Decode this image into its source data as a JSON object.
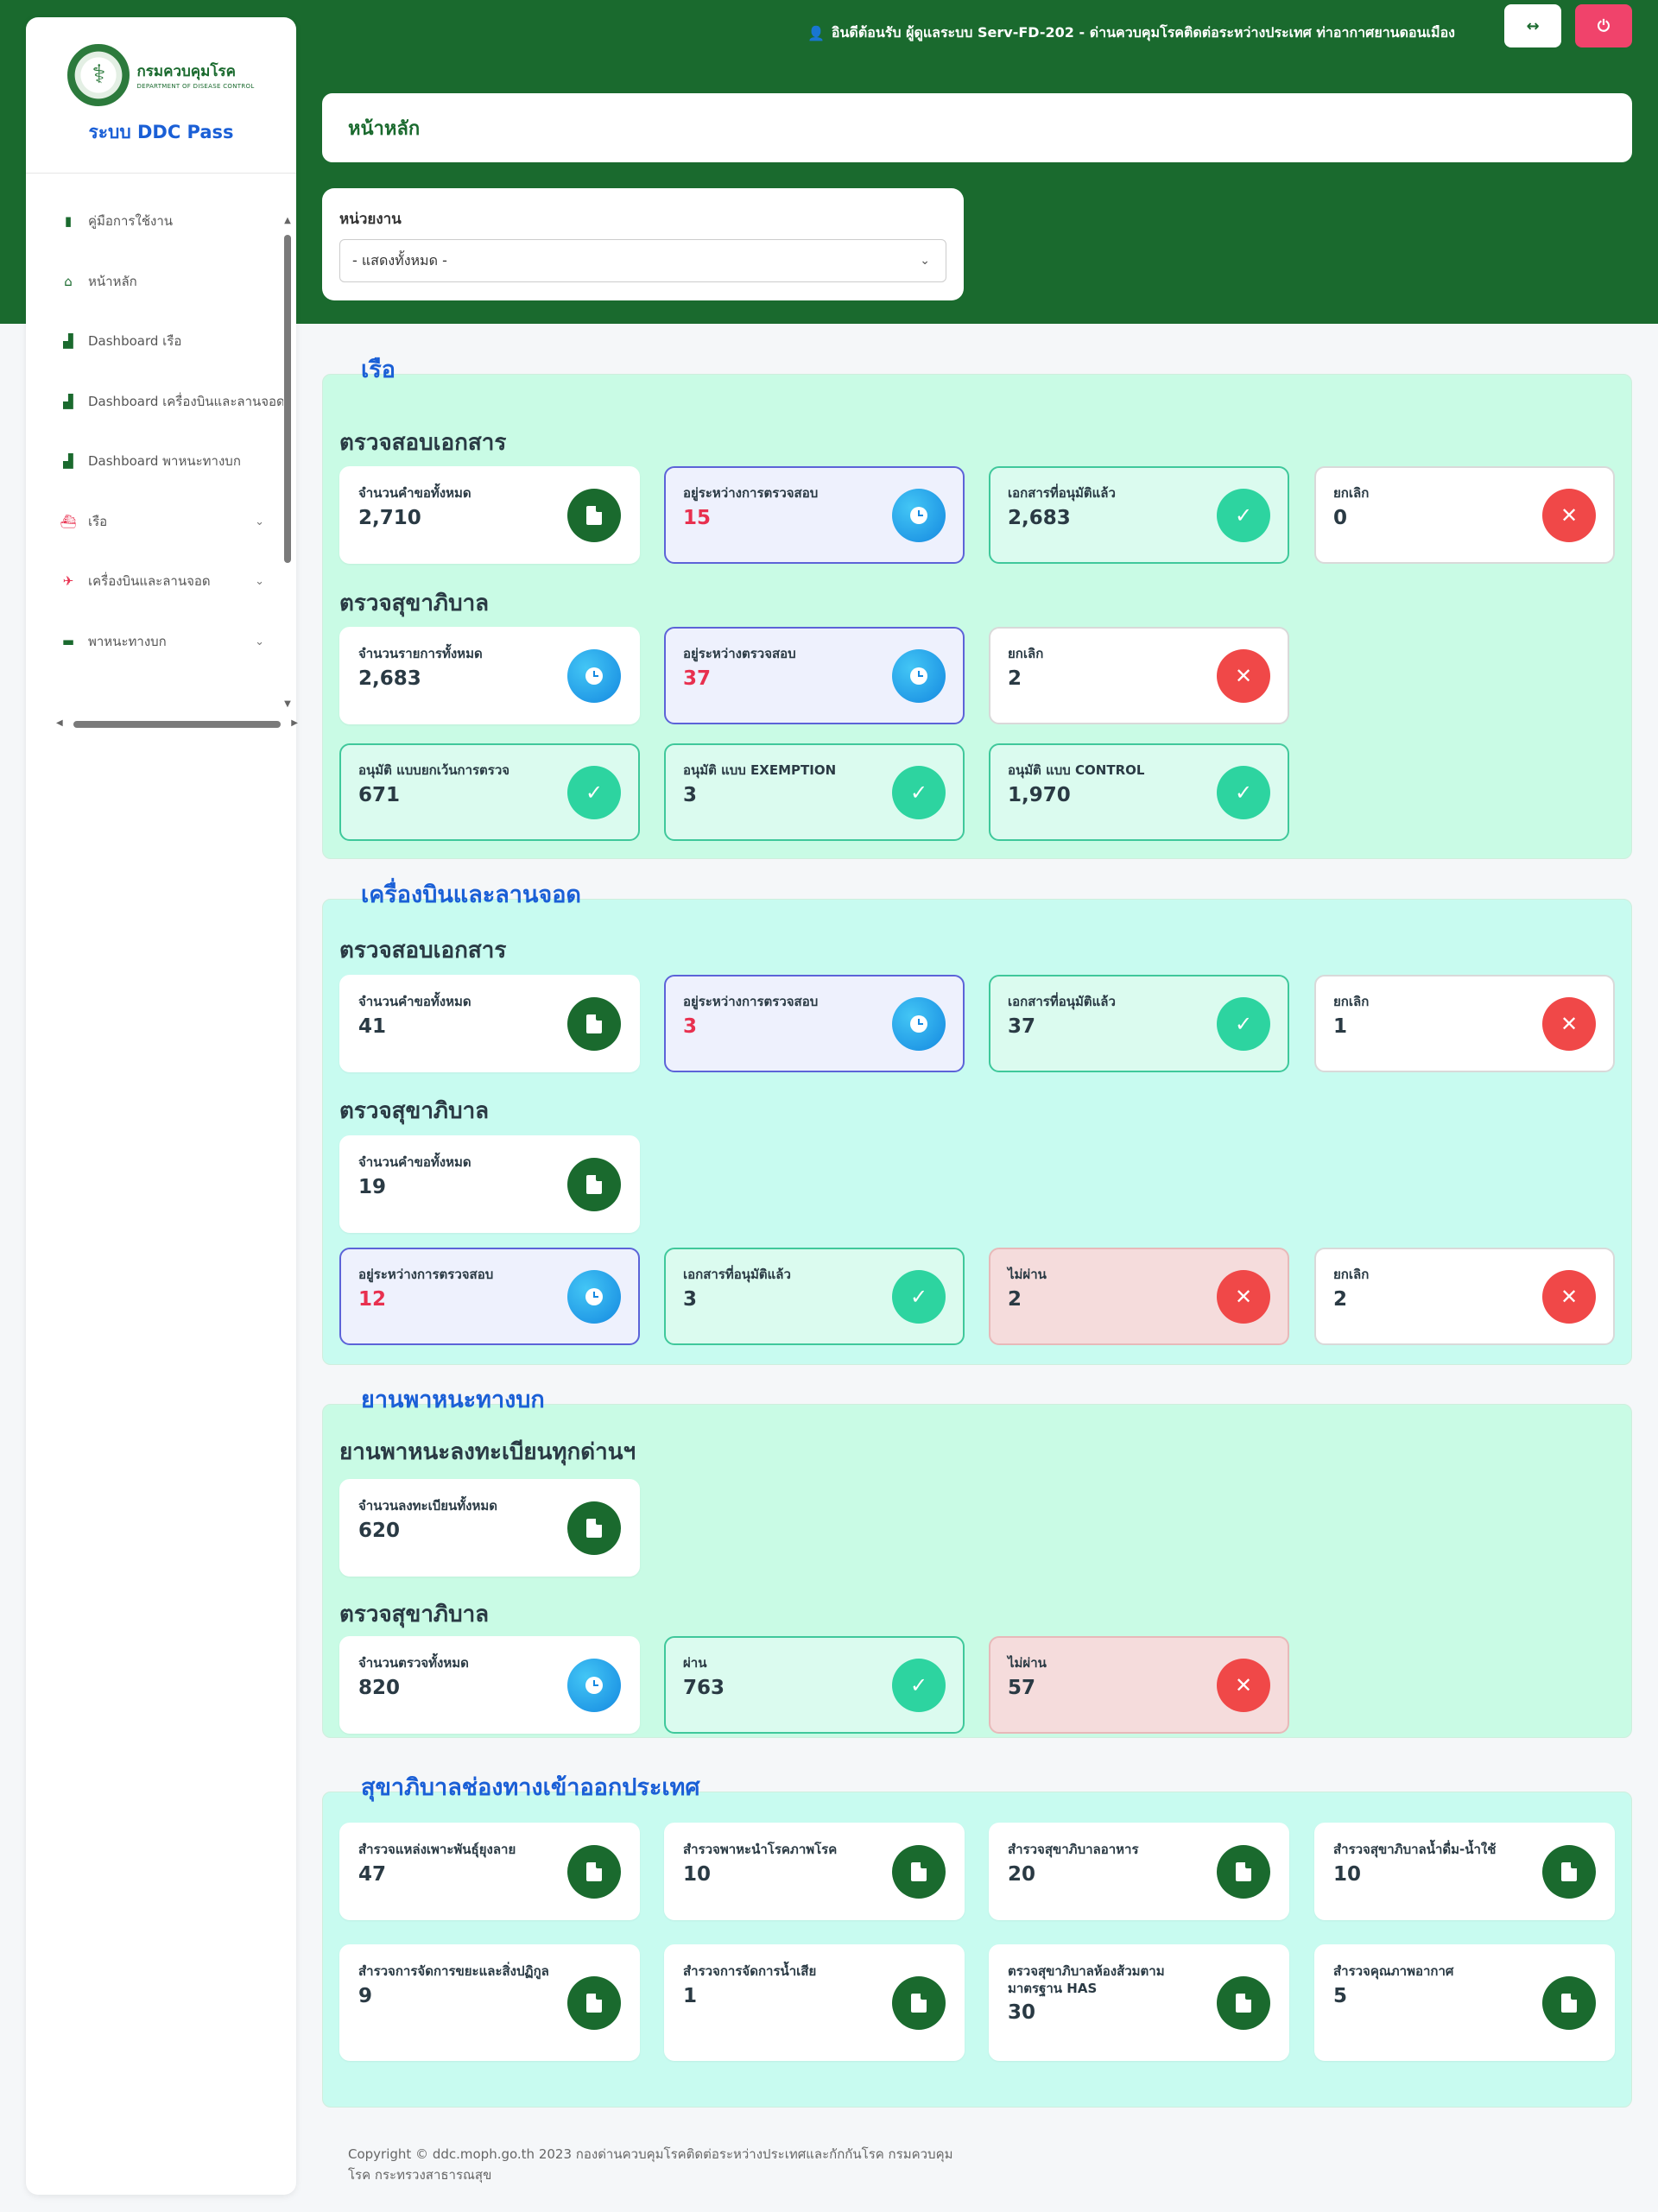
{
  "header": {
    "welcome": "อินดีต้อนรับ ผู้ดูแลระบบ Serv-FD-202 - ด่านควบคุมโรคติดต่อระหว่างประเทศ ท่าอากาศยานดอนเมือง",
    "user_icon": "user-icon",
    "toggle_icon": "arrows-horizontal-icon",
    "power_icon": "power-icon"
  },
  "sidebar": {
    "logo_th": "กรมควบคุมโรค",
    "logo_en": "DEPARTMENT OF DISEASE CONTROL",
    "system_name": "ระบบ DDC Pass",
    "items": [
      {
        "label": "คู่มือการใช้งาน",
        "icon": "book-icon"
      },
      {
        "label": "หน้าหลัก",
        "icon": "store-icon"
      },
      {
        "label": "Dashboard เรือ",
        "icon": "chart-icon"
      },
      {
        "label": "Dashboard เครื่องบินและลานจอด",
        "icon": "chart-icon"
      },
      {
        "label": "Dashboard พาหนะทางบก",
        "icon": "chart-icon"
      },
      {
        "label": "เรือ",
        "icon": "ship-icon"
      },
      {
        "label": "เครื่องบินและลานจอด",
        "icon": "plane-icon"
      },
      {
        "label": "พาหนะทางบก",
        "icon": "truck-icon"
      }
    ]
  },
  "page": {
    "title": "หน้าหลัก",
    "filter_label": "หน่วยงาน",
    "filter_value": "- แสดงทั้งหมด -"
  },
  "sections": {
    "ship": {
      "title": "เรือ",
      "docs_title": "ตรวจสอบเอกสาร",
      "docs": [
        {
          "label": "จำนวนคำขอทั้งหมด",
          "value": "2,710"
        },
        {
          "label": "อยู่ระหว่างการตรวจสอบ",
          "value": "15"
        },
        {
          "label": "เอกสารที่อนุมัติแล้ว",
          "value": "2,683"
        },
        {
          "label": "ยกเลิก",
          "value": "0"
        }
      ],
      "sanitation_title": "ตรวจสุขาภิบาล",
      "sanitation": [
        {
          "label": "จำนวนรายการทั้งหมด",
          "value": "2,683"
        },
        {
          "label": "อยู่ระหว่างตรวจสอบ",
          "value": "37"
        },
        {
          "label": "ยกเลิก",
          "value": "2"
        },
        {
          "label": "อนุมัติ แบบยกเว้นการตรวจ",
          "value": "671"
        },
        {
          "label": "อนุมัติ แบบ EXEMPTION",
          "value": "3"
        },
        {
          "label": "อนุมัติ แบบ CONTROL",
          "value": "1,970"
        }
      ]
    },
    "air": {
      "title": "เครื่องบินและลานจอด",
      "docs_title": "ตรวจสอบเอกสาร",
      "docs": [
        {
          "label": "จำนวนคำขอทั้งหมด",
          "value": "41"
        },
        {
          "label": "อยู่ระหว่างการตรวจสอบ",
          "value": "3"
        },
        {
          "label": "เอกสารที่อนุมัติแล้ว",
          "value": "37"
        },
        {
          "label": "ยกเลิก",
          "value": "1"
        }
      ],
      "sanitation_title": "ตรวจสุขาภิบาล",
      "sanitation": [
        {
          "label": "จำนวนคำขอทั้งหมด",
          "value": "19"
        },
        {
          "label": "อยู่ระหว่างการตรวจสอบ",
          "value": "12"
        },
        {
          "label": "เอกสารที่อนุมัติแล้ว",
          "value": "3"
        },
        {
          "label": "ไม่ผ่าน",
          "value": "2"
        },
        {
          "label": "ยกเลิก",
          "value": "2"
        }
      ]
    },
    "land": {
      "title": "ยานพาหนะทางบก",
      "reg_title": "ยานพาหนะลงทะเบียนทุกด่านฯ",
      "reg": [
        {
          "label": "จำนวนลงทะเบียนทั้งหมด",
          "value": "620"
        }
      ],
      "sanitation_title": "ตรวจสุขาภิบาล",
      "sanitation": [
        {
          "label": "จำนวนตรวจทั้งหมด",
          "value": "820"
        },
        {
          "label": "ผ่าน",
          "value": "763"
        },
        {
          "label": "ไม่ผ่าน",
          "value": "57"
        }
      ]
    },
    "port": {
      "title": "สุขาภิบาลช่องทางเข้าออกประเทศ",
      "items": [
        {
          "label": "สำรวจแหล่งเพาะพันธุ์ยุงลาย",
          "value": "47"
        },
        {
          "label": "สำรวจพาหะนำโรคภาพโรค",
          "value": "10"
        },
        {
          "label": "สำรวจสุขาภิบาลอาหาร",
          "value": "20"
        },
        {
          "label": "สำรวจสุขาภิบาลน้ำดื่ม-น้ำใช้",
          "value": "10"
        },
        {
          "label": "สำรวจการจัดการขยะและสิ่งปฏิกูล",
          "value": "9"
        },
        {
          "label": "สำรวจการจัดการน้ำเสีย",
          "value": "1"
        },
        {
          "label": "ตรวจสุขาภิบาลห้องส้วมตามมาตรฐาน HAS",
          "value": "30"
        },
        {
          "label": "สำรวจคุณภาพอากาศ",
          "value": "5"
        }
      ]
    }
  },
  "footer": "Copyright © ddc.moph.go.th 2023 กองด่านควบคุมโรคติดต่อระหว่างประเทศและกักกันโรค กรมควบคุมโรค กระทรวงสาธารณสุข",
  "colors": {
    "brand_green": "#1a6a2e",
    "accent_blue": "#1a5fd6",
    "section_mint": "#c9fbe5",
    "section_aqua": "#c8fbf0",
    "danger": "#f04848",
    "pending_red": "#e8304f"
  }
}
